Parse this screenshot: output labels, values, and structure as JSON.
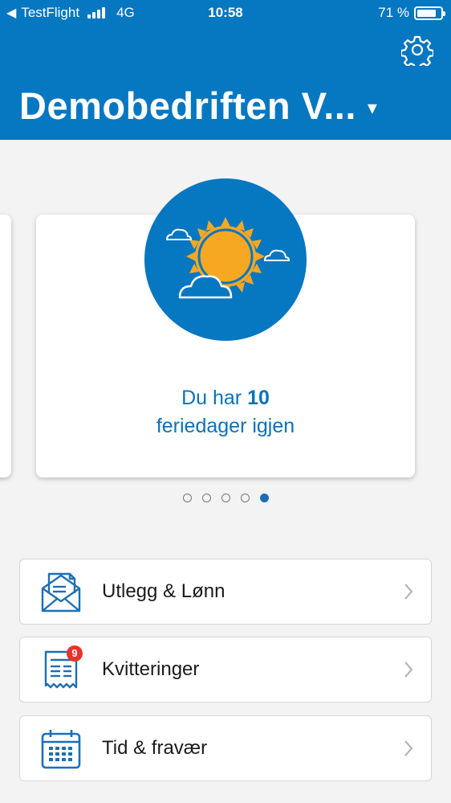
{
  "status_bar": {
    "back_app": "TestFlight",
    "network": "4G",
    "time": "10:58",
    "battery": "71 %",
    "battery_level": 0.71
  },
  "header": {
    "company_name": "Demobedriften V...",
    "caret": "▾",
    "background_color": "#0677c1"
  },
  "carousel": {
    "text_prefix": "Du har ",
    "days": "10",
    "text_suffix": "feriedager igjen",
    "page_count": 5,
    "active_page": 5,
    "icon": "sun-with-clouds-icon"
  },
  "menu": [
    {
      "label": "Utlegg & Lønn",
      "icon": "envelope-document-icon"
    },
    {
      "label": "Kvitteringer",
      "icon": "receipt-icon",
      "badge": "9"
    },
    {
      "label": "Tid & fravær",
      "icon": "calendar-icon"
    }
  ]
}
